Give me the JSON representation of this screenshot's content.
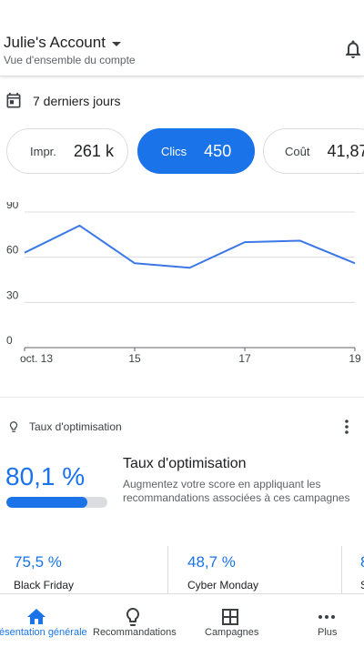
{
  "header": {
    "account_title": "Julie's Account",
    "subtitle": "Vue d'ensemble du compte"
  },
  "date_range": {
    "label": "7 derniers jours"
  },
  "metrics": [
    {
      "label": "Impr.",
      "value": "261 k",
      "active": false
    },
    {
      "label": "Clics",
      "value": "450",
      "active": true
    },
    {
      "label": "Coût",
      "value": "41,87",
      "active": false
    }
  ],
  "chart_data": {
    "type": "line",
    "x_ticks": [
      "oct. 13",
      "15",
      "17",
      "19"
    ],
    "y_ticks": [
      "90",
      "60",
      "30",
      "0"
    ],
    "x": [
      "oct. 13",
      "oct. 14",
      "oct. 15",
      "oct. 16",
      "oct. 17",
      "oct. 18",
      "oct. 19"
    ],
    "values": [
      63,
      81,
      56,
      53,
      70,
      71,
      56
    ],
    "ylim": [
      0,
      90
    ],
    "grid": true,
    "line_color": "#3b78e7"
  },
  "optimization": {
    "header_label": "Taux d'optimisation",
    "score": "80,1 %",
    "score_fraction": 0.801,
    "title": "Taux d'optimisation",
    "description": "Augmentez votre score en appliquant les recommandations associées à ces campagnes",
    "cards": [
      {
        "percent": "75,5 %",
        "name": "Black Friday"
      },
      {
        "percent": "48,7 %",
        "name": "Cyber Monday"
      },
      {
        "percent": "8",
        "name": "S"
      }
    ]
  },
  "nav": [
    {
      "label": "Présentation générale",
      "icon": "home-icon",
      "active": true
    },
    {
      "label": "Recommandations",
      "icon": "lightbulb-icon",
      "active": false
    },
    {
      "label": "Campagnes",
      "icon": "table-icon",
      "active": false
    },
    {
      "label": "Plus",
      "icon": "more-horizontal-icon",
      "active": false
    }
  ],
  "colors": {
    "accent": "#1a73e8",
    "text": "#202124",
    "muted": "#5f6368",
    "border": "#dadce0"
  }
}
